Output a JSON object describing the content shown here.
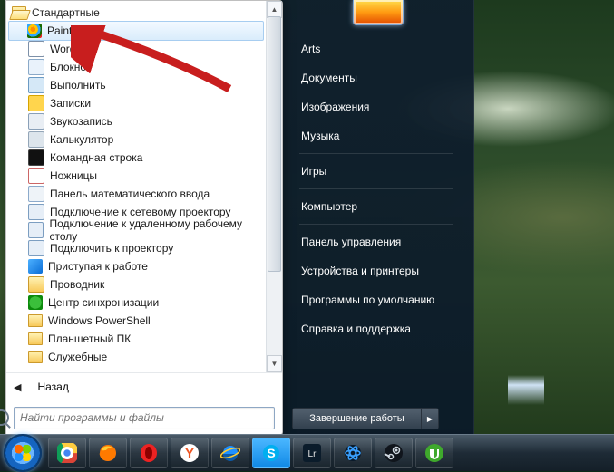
{
  "start_menu": {
    "folder_open_label": "Стандартные",
    "items": [
      {
        "id": "paint",
        "label": "Paint",
        "icon": "paint",
        "selected": true
      },
      {
        "id": "wordpad",
        "label": "WordPad",
        "icon": "wordpad"
      },
      {
        "id": "notepad",
        "label": "Блокнот",
        "icon": "notepad"
      },
      {
        "id": "run",
        "label": "Выполнить",
        "icon": "run"
      },
      {
        "id": "sticky",
        "label": "Записки",
        "icon": "sticky"
      },
      {
        "id": "soundrec",
        "label": "Звукозапись",
        "icon": "soundrec"
      },
      {
        "id": "calc",
        "label": "Калькулятор",
        "icon": "calc"
      },
      {
        "id": "cmd",
        "label": "Командная строка",
        "icon": "cmd"
      },
      {
        "id": "snip",
        "label": "Ножницы",
        "icon": "snip"
      },
      {
        "id": "mathpanel",
        "label": "Панель математического ввода",
        "icon": "mathpanel"
      },
      {
        "id": "netproj",
        "label": "Подключение к сетевому проектору",
        "icon": "netproj"
      },
      {
        "id": "rdp",
        "label": "Подключение к удаленному рабочему столу",
        "icon": "rdp"
      },
      {
        "id": "proj",
        "label": "Подключить к проектору",
        "icon": "proj"
      },
      {
        "id": "gettingstarted",
        "label": "Приступая к работе",
        "icon": "gettingstarted"
      },
      {
        "id": "explorer",
        "label": "Проводник",
        "icon": "explorer"
      },
      {
        "id": "sync",
        "label": "Центр синхронизации",
        "icon": "sync"
      }
    ],
    "sub_folders": [
      {
        "label": "Windows PowerShell"
      },
      {
        "label": "Планшетный ПК"
      },
      {
        "label": "Служебные"
      }
    ],
    "back_label": "Назад",
    "search_placeholder": "Найти программы и файлы"
  },
  "right_column": {
    "groups": [
      [
        "Arts",
        "Документы",
        "Изображения",
        "Музыка"
      ],
      [
        "Игры"
      ],
      [
        "Компьютер"
      ],
      [
        "Панель управления",
        "Устройства и принтеры",
        "Программы по умолчанию",
        "Справка и поддержка"
      ]
    ],
    "shutdown_label": "Завершение работы"
  },
  "taskbar": {
    "icons": [
      "start-orb",
      "chrome-icon",
      "firefox-icon",
      "opera-icon",
      "yandex-icon",
      "ie-icon",
      "skype-icon",
      "lightroom-icon",
      "battlenet-icon",
      "steam-icon",
      "utorrent-icon"
    ]
  },
  "colors": {
    "selection_border": "#a7cdf0",
    "arrow": "#c81e1e"
  }
}
